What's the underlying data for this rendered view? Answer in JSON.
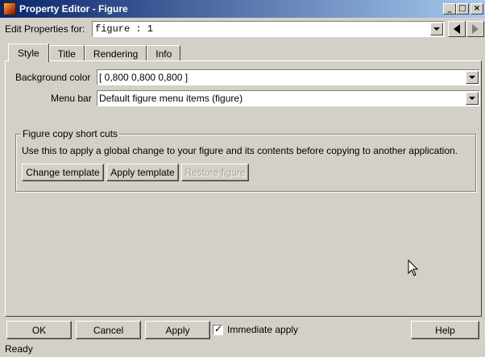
{
  "window": {
    "title": "Property Editor - Figure"
  },
  "edit_for": {
    "label": "Edit Properties for:",
    "value": "figure : 1"
  },
  "tabs": [
    {
      "label": "Style",
      "active": true
    },
    {
      "label": "Title",
      "active": false
    },
    {
      "label": "Rendering",
      "active": false
    },
    {
      "label": "Info",
      "active": false
    }
  ],
  "style_tab": {
    "background_color": {
      "label": "Background color",
      "value": "[ 0,800 0,800 0,800 ]"
    },
    "menu_bar": {
      "label": "Menu bar",
      "value": "Default figure menu items (figure)"
    }
  },
  "copy_shortcuts": {
    "title": "Figure copy short cuts",
    "description": "Use this to apply a global change to your figure and its contents before copying to another application.",
    "buttons": {
      "change_template": "Change template",
      "apply_template": "Apply template",
      "restore_figure": "Restore figure"
    }
  },
  "footer": {
    "ok": "OK",
    "cancel": "Cancel",
    "apply": "Apply",
    "immediate_apply": {
      "label": "Immediate apply",
      "checked": true
    },
    "help": "Help"
  },
  "status": "Ready",
  "colors": {
    "titlebar_start": "#0a246a",
    "titlebar_end": "#a6caf0",
    "face": "#d4d0c8"
  }
}
